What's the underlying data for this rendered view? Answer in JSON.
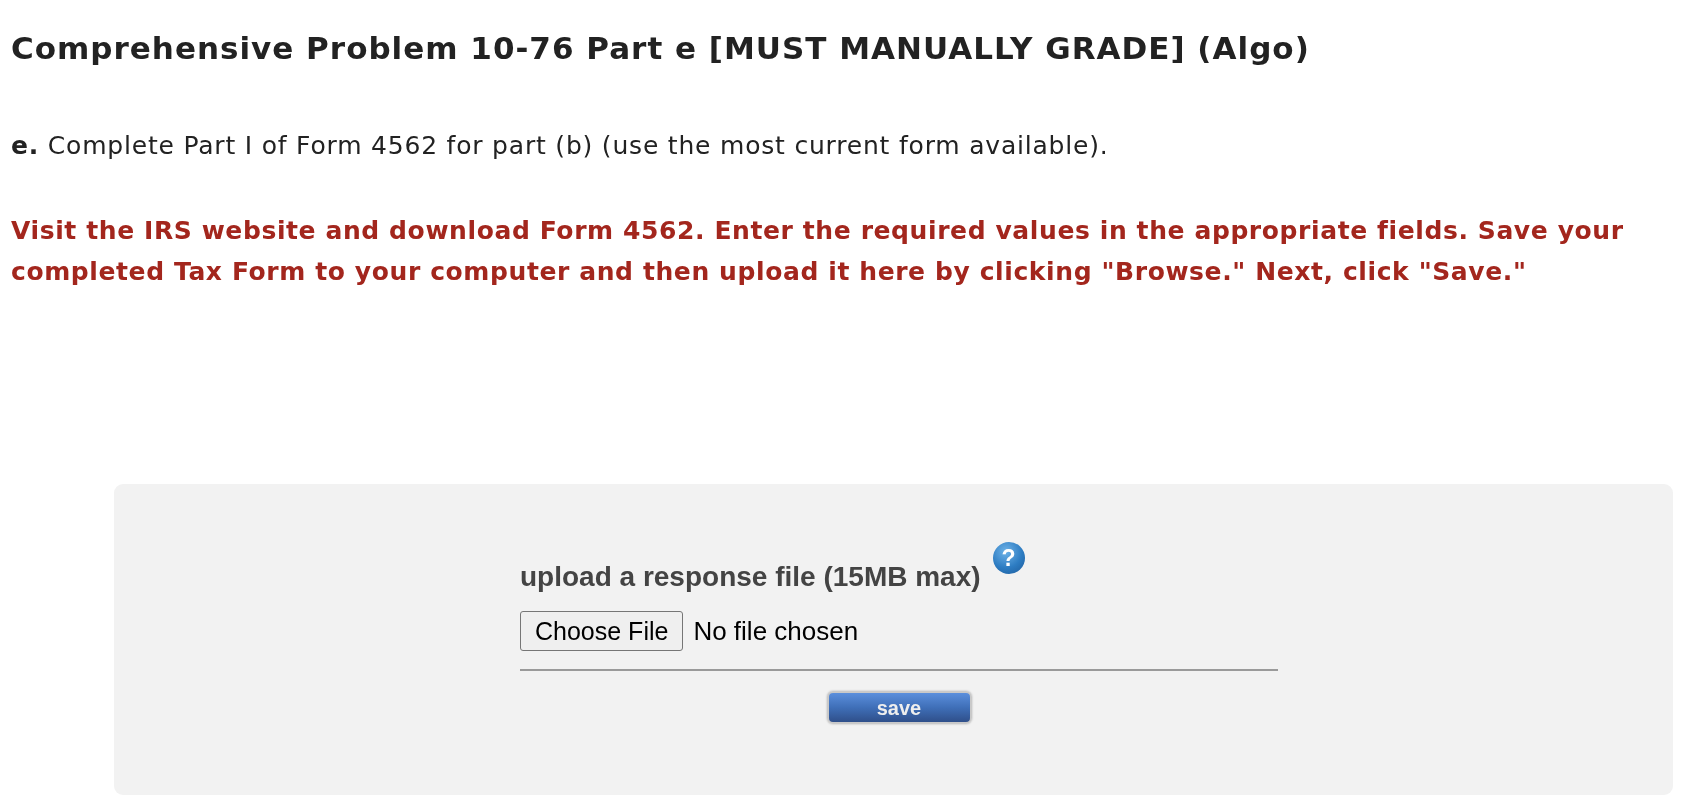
{
  "title": "Comprehensive Problem 10-76 Part e [MUST MANUALLY GRADE] (Algo)",
  "question": {
    "prompt": "**e.** Complete Part I of Form 4562 for part (b) (use the most current form available).",
    "instructions": "Visit the IRS website and download Form 4562. Enter the required values in the appropriate fields. Save your completed Tax Form to your computer and then upload it here by clicking \"Browse.\" Next, click \"Save.\""
  },
  "upload_panel": {
    "label": "upload a response file (15MB max)",
    "help_icon": "?",
    "choose_button": "Choose File",
    "file_status": "No file chosen",
    "save_button": "save"
  }
}
